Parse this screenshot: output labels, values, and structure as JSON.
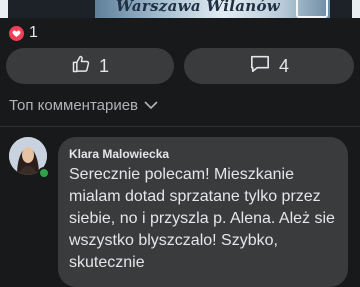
{
  "banner": {
    "text": "Warszawa Wilanów"
  },
  "reactions": {
    "icon": "heart-icon",
    "count": "1",
    "color": "#f33e58"
  },
  "actions": {
    "like": {
      "icon": "thumbs-up-icon",
      "count": "1"
    },
    "comment": {
      "icon": "comment-icon",
      "count": "4"
    }
  },
  "comments_header": {
    "sort_label": "Топ комментариев",
    "icon": "chevron-down-icon"
  },
  "comment": {
    "author": "Klara Malowiecka",
    "text": "Serecznie polecam! Mieszkanie mialam dotad sprzatane tylko przez siebie, no i przyszla p. Alena. Ależ sie wszystko blyszczalo! Szybko, skutecznie",
    "status_color": "#31a24c"
  }
}
